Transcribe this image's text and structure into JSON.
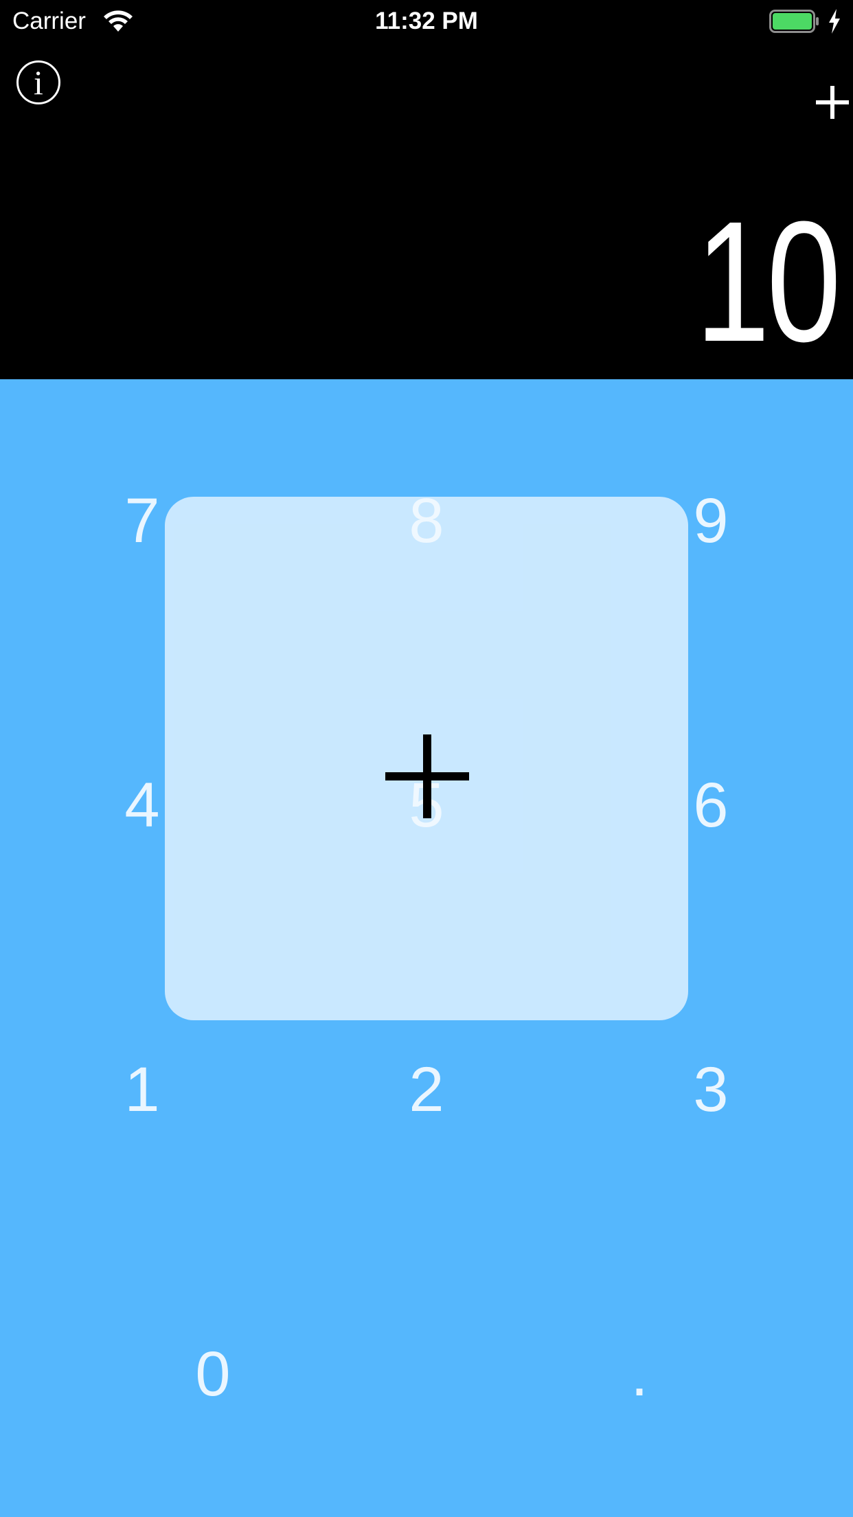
{
  "status_bar": {
    "carrier": "Carrier",
    "time": "11:32 PM",
    "wifi_icon": "wifi-icon",
    "battery_icon": "battery-icon",
    "charging_icon": "charging-bolt-icon",
    "battery_color": "#4cd964"
  },
  "header": {
    "info_label": "i",
    "operation_icon": "plus-icon"
  },
  "display": {
    "value": "10"
  },
  "keypad": {
    "background": "#55b7fd",
    "keys": {
      "k7": "7",
      "k8": "8",
      "k9": "9",
      "k4": "4",
      "k5": "5",
      "k6": "6",
      "k1": "1",
      "k2": "2",
      "k3": "3",
      "k0": "0",
      "kdot": "."
    }
  },
  "operation_overlay": {
    "icon": "plus-icon"
  }
}
